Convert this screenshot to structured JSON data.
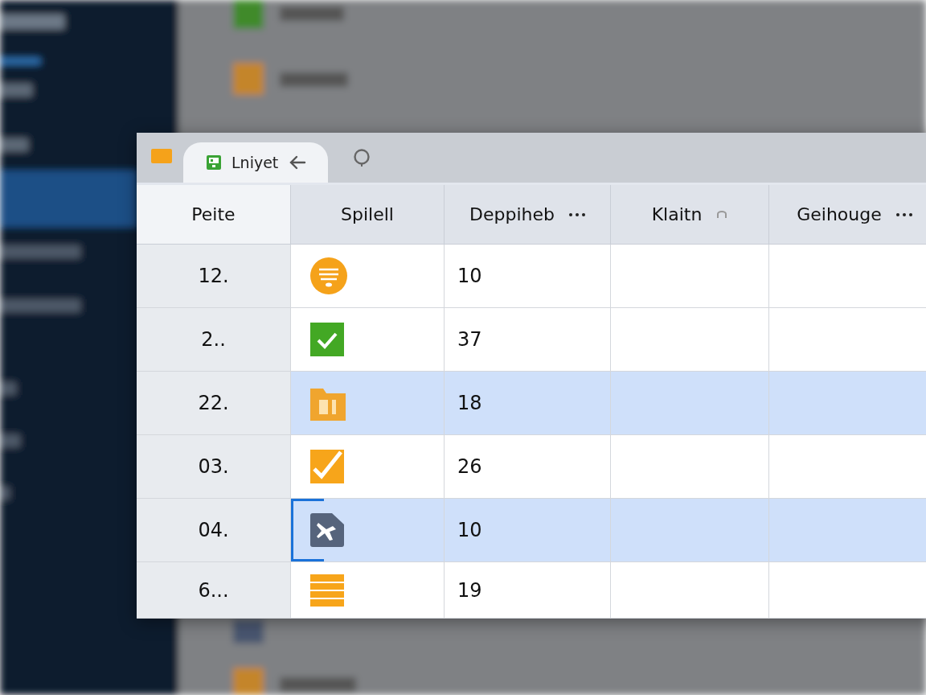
{
  "window": {
    "tabs": [
      {
        "label": "Lniyet",
        "selected": true
      }
    ]
  },
  "table": {
    "columns": [
      {
        "label": "Peite",
        "menu": false,
        "kind": "plain"
      },
      {
        "label": "Spilell",
        "menu": false,
        "kind": "plain"
      },
      {
        "label": "Deppiheb",
        "menu": true,
        "kind": "plain"
      },
      {
        "label": "Klaitn",
        "menu": false,
        "kind": "sort"
      },
      {
        "label": "Geihouge",
        "menu": true,
        "kind": "plain"
      }
    ],
    "rows": [
      {
        "number": "12.",
        "kind": "list-circle",
        "value": "10",
        "selected": false,
        "focused": false
      },
      {
        "number": "2..",
        "kind": "check-green",
        "value": "37",
        "selected": false,
        "focused": false
      },
      {
        "number": "22.",
        "kind": "folder",
        "value": "18",
        "selected": true,
        "focused": false
      },
      {
        "number": "03.",
        "kind": "check-orange",
        "value": "26",
        "selected": false,
        "focused": false
      },
      {
        "number": "04.",
        "kind": "tag",
        "value": "10",
        "selected": true,
        "focused": true
      },
      {
        "number": "6...",
        "kind": "lines",
        "value": "19",
        "selected": false,
        "focused": false
      }
    ]
  }
}
